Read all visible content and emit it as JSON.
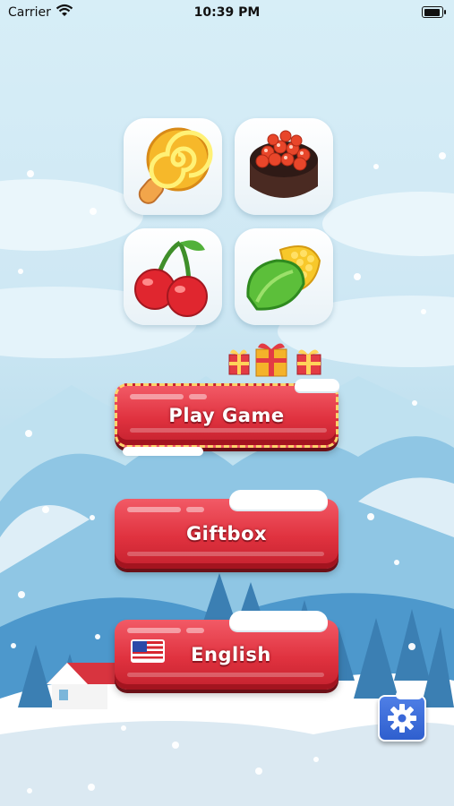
{
  "status_bar": {
    "carrier": "Carrier",
    "time": "10:39 PM"
  },
  "food_tiles": [
    {
      "icon": "lollipop-icon"
    },
    {
      "icon": "sushi-roe-icon"
    },
    {
      "icon": "cherries-icon"
    },
    {
      "icon": "corn-icon"
    }
  ],
  "menu": {
    "play_label": "Play Game",
    "giftbox_label": "Giftbox",
    "language_label": "English"
  },
  "colors": {
    "button_red": "#e0323f",
    "settings_blue": "#2f5fce"
  }
}
